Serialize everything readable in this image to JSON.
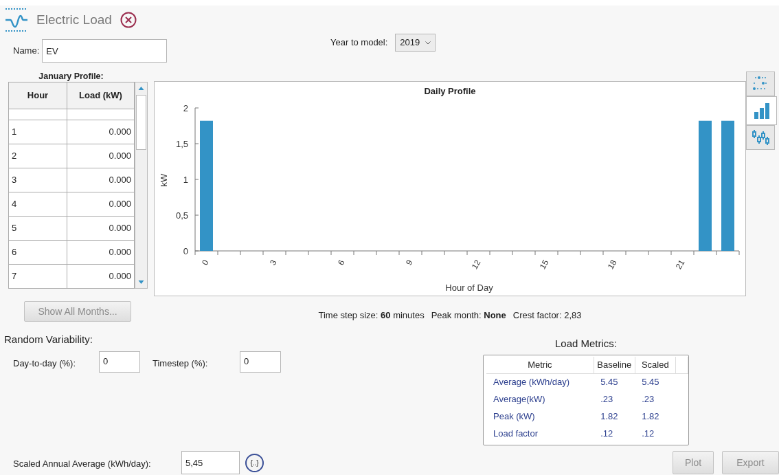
{
  "header": {
    "title": "Electric Load"
  },
  "name_field": {
    "label": "Name:",
    "value": "EV"
  },
  "year_field": {
    "label": "Year to model:",
    "value": "2019"
  },
  "profile": {
    "caption": "January Profile:",
    "columns": [
      "Hour",
      "Load (kW)"
    ],
    "rows": [
      {
        "hour": "1",
        "load": "0.000"
      },
      {
        "hour": "2",
        "load": "0.000"
      },
      {
        "hour": "3",
        "load": "0.000"
      },
      {
        "hour": "4",
        "load": "0.000"
      },
      {
        "hour": "5",
        "load": "0.000"
      },
      {
        "hour": "6",
        "load": "0.000"
      },
      {
        "hour": "7",
        "load": "0.000"
      }
    ]
  },
  "show_all_button": {
    "label": "Show All Months...",
    "disabled": true
  },
  "chart": {
    "chart_data": {
      "type": "bar",
      "title": "Daily Profile",
      "xlabel": "Hour of Day",
      "ylabel": "kW",
      "x": [
        0,
        1,
        2,
        3,
        4,
        5,
        6,
        7,
        8,
        9,
        10,
        11,
        12,
        13,
        14,
        15,
        16,
        17,
        18,
        19,
        20,
        21,
        22,
        23
      ],
      "values": [
        1.82,
        0,
        0,
        0,
        0,
        0,
        0,
        0,
        0,
        0,
        0,
        0,
        0,
        0,
        0,
        0,
        0,
        0,
        0,
        0,
        0,
        0,
        1.82,
        1.82
      ],
      "xlim": [
        -0.5,
        23.5
      ],
      "ylim": [
        0,
        2
      ],
      "xticks": [
        0,
        3,
        6,
        9,
        12,
        15,
        18,
        21
      ],
      "yticks": [
        {
          "value": 0,
          "label": "0"
        },
        {
          "value": 0.5,
          "label": "0,5"
        },
        {
          "value": 1,
          "label": "1"
        },
        {
          "value": 1.5,
          "label": "1,5"
        },
        {
          "value": 2,
          "label": "2"
        }
      ]
    }
  },
  "chart_types": [
    {
      "kind": "scatter",
      "selected": false
    },
    {
      "kind": "bar",
      "selected": true
    },
    {
      "kind": "candle",
      "selected": false
    }
  ],
  "info": [
    {
      "text": "Time step size: **60** minutes"
    },
    {
      "text": "Peak month: **None**"
    },
    {
      "text": "Crest factor: 2,83"
    }
  ],
  "variability": {
    "title": "Random Variability:",
    "fields": [
      {
        "label": "Day-to-day (%):",
        "value": "0"
      },
      {
        "label": "Timestep (%):",
        "value": "0"
      }
    ]
  },
  "metrics": {
    "title": "Load Metrics:",
    "columns": [
      "Metric",
      "Baseline",
      "Scaled"
    ],
    "rows": [
      [
        "Average (kWh/day)",
        "5.45",
        "5.45"
      ],
      [
        "Average(kW)",
        ".23",
        ".23"
      ],
      [
        "Peak (kW)",
        "1.82",
        "1.82"
      ],
      [
        "Load factor",
        ".12",
        ".12"
      ]
    ]
  },
  "scaled": {
    "label": "Scaled Annual Average (kWh/day):",
    "value": "5,45",
    "button": "{..}"
  },
  "actions": [
    {
      "label": "Plot",
      "disabled": true
    },
    {
      "label": "Export",
      "disabled": true
    }
  ]
}
